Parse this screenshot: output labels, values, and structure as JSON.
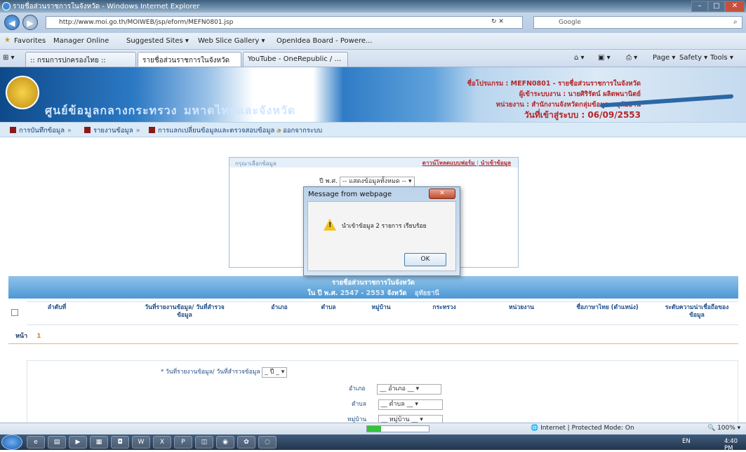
{
  "window": {
    "title": "รายชื่อส่วนราชการในจังหวัด - Windows Internet Explorer",
    "min": "–",
    "max": "□",
    "close": "✕"
  },
  "address": {
    "url": "http://www.moi.go.th/MOIWEB/jsp/eform/MEFN0801.jsp",
    "search": "Google"
  },
  "favorites": {
    "label": "Favorites",
    "items": [
      "Manager Online",
      "Suggested Sites ▾",
      "Web Slice Gallery ▾",
      "OpenIdea Board - Powere..."
    ]
  },
  "tabs": [
    {
      "label": ":: กรมการปกครองไทย ::"
    },
    {
      "label": "รายชื่อส่วนราชการในจังหวัด"
    },
    {
      "label": "YouTube - OneRepublic / ..."
    }
  ],
  "commandbar": [
    "Page ▾",
    "Safety ▾",
    "Tools ▾"
  ],
  "banner": {
    "left_text": "ศูนย์ข้อมูลกลางกระทรวง",
    "mid_text": "มหาดไทยและจังหวัด",
    "program": "ชื่อโปรแกรม : MEFN0801 - รายชื่อส่วนราชการในจังหวัด",
    "user": "ผู้เข้าระบบงาน : นายศิริรัตน์ ผลิตพนานิตย์",
    "org": "หน่วยงาน : สำนักงานจังหวัดกลุ่มข้อมูล - อุทัยธานี",
    "date": "วันที่เข้าสู่ระบบ : 06/09/2553"
  },
  "menu": [
    "การบันทึกข้อมูล",
    "รายงานข้อมูล",
    "การแลกเปลี่ยนข้อมูลและตรวจสอบข้อมูล",
    "ออกจากระบบ"
  ],
  "panel": {
    "head": "กรุณาเลือกข้อมูล",
    "download": "ดาวน์โหลดแบบฟอร์ม",
    "import": "นำเข้าข้อมูล",
    "year_label": "ปี พ.ศ.",
    "year_value": "-- แสดงข้อมูลทั้งหมด --"
  },
  "dialog": {
    "title": "Message from webpage",
    "message": "นำเข้าข้อมูล 2 รายการ เรียบร้อย",
    "ok": "OK"
  },
  "list": {
    "title": "รายชื่อส่วนราชการในจังหวัด",
    "subtitle_prefix": "ใน ปี พ.ศ.",
    "years": "2547 - 2553",
    "province_label": "จังหวัด",
    "province": "อุทัยธานี",
    "columns": [
      "ลำดับที่",
      "วันที่รายงานข้อมูล/ วันที่สำรวจข้อมูล",
      "อำเภอ",
      "ตำบล",
      "หมู่บ้าน",
      "กระทรวง",
      "หน่วยงาน",
      "ชื่อภาษาไทย (ตำแหน่ง)",
      "ระดับความน่าเชื่อถือของข้อมูล"
    ]
  },
  "pager": {
    "label": "หน้า",
    "page": "1"
  },
  "form": [
    {
      "label": "* วันที่รายงานข้อมูล/ วันที่สำรวจข้อมูล",
      "value": "_ ปี _"
    },
    {
      "label": "อำเภอ",
      "value": "__ อำเภอ __"
    },
    {
      "label": "ตำบล",
      "value": "__ ตำบล __"
    },
    {
      "label": "หมู่บ้าน",
      "value": "__ หมู่บ้าน __"
    }
  ],
  "status": {
    "zone": "Internet | Protected Mode: On",
    "zoom": "100%"
  },
  "taskbar": {
    "lang": "EN",
    "time": "4:40 PM"
  }
}
